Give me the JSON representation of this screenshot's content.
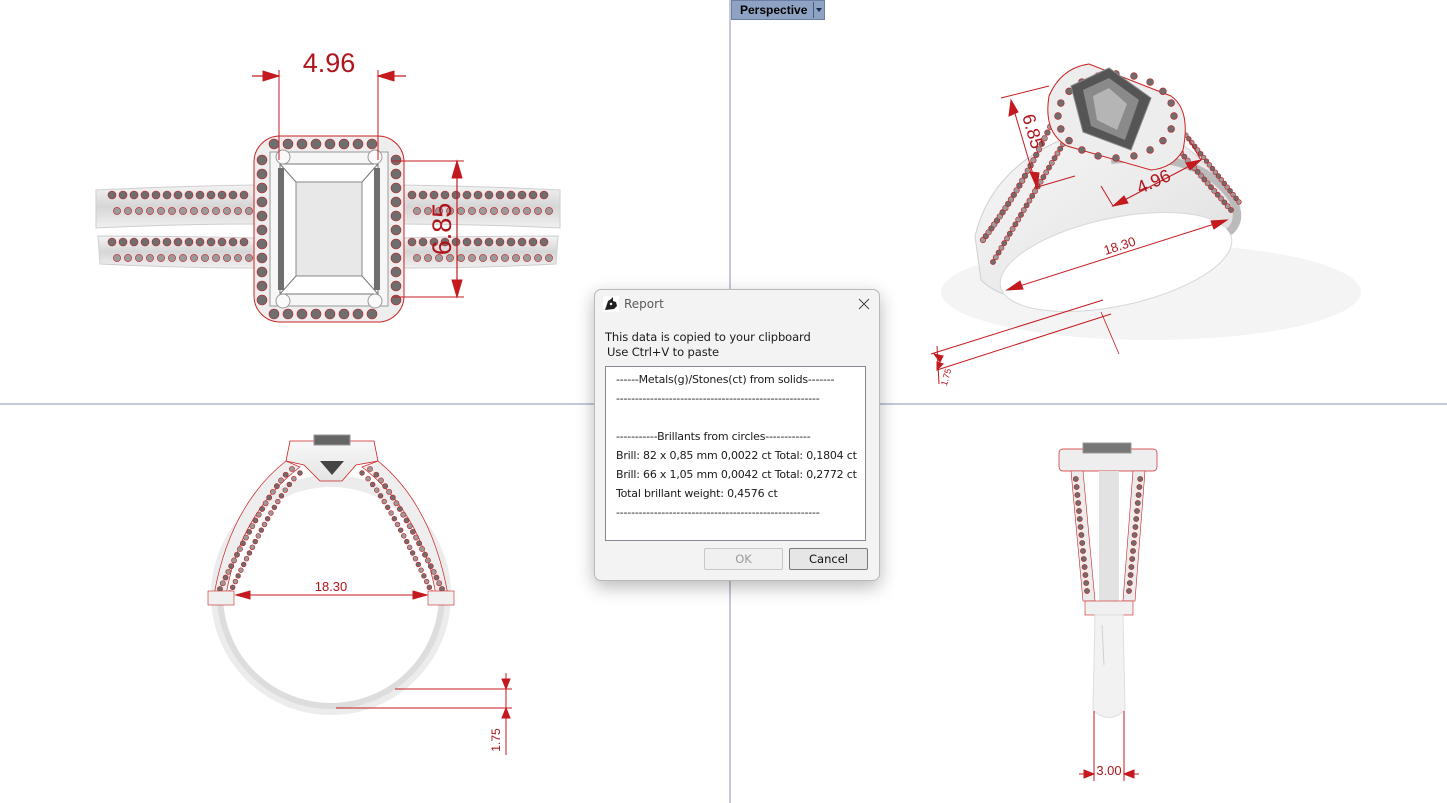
{
  "viewport": {
    "active_tab": "Perspective"
  },
  "dimensions": {
    "top_width": "4.96",
    "top_height": "6.85",
    "persp_height": "6.85",
    "persp_width": "4.96",
    "persp_diameter": "18.30",
    "persp_thickness": "1.75",
    "front_diameter": "18.30",
    "front_thickness": "1.75",
    "side_width": "3.00"
  },
  "dialog": {
    "title": "Report",
    "message_line1": "This data is copied to your clipboard",
    "message_line2": "Use Ctrl+V to paste",
    "report_lines": [
      "------Metals(g)/Stones(ct) from solids-------",
      "------------------------------------------------------",
      "",
      "-----------Brillants from circles------------",
      "Brill: 82 x 0,85 mm 0,0022 ct Total: 0,1804 ct",
      "Brill: 66 x 1,05 mm 0,0042 ct Total: 0,2772 ct",
      "Total brillant weight: 0,4576 ct",
      "------------------------------------------------------"
    ],
    "ok_label": "OK",
    "cancel_label": "Cancel"
  },
  "colors": {
    "dimension": "#b0141b",
    "metal": "#e9e9e9",
    "viewport_tab": "#8ea3c4",
    "splitter": "#c4c8d8"
  }
}
